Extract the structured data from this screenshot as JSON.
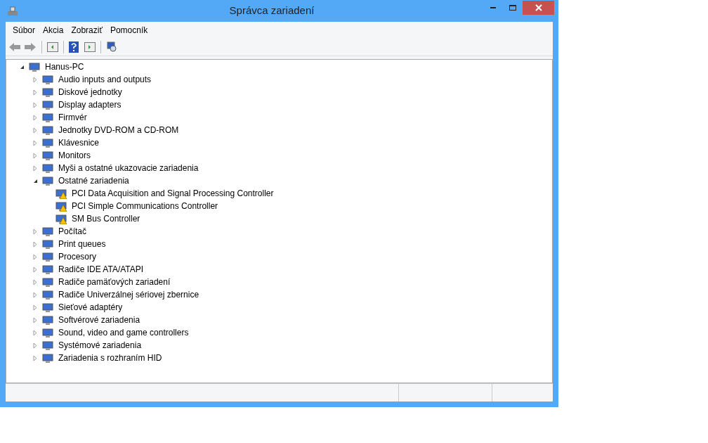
{
  "window": {
    "title": "Správca zariadení"
  },
  "menu": [
    "Súbor",
    "Akcia",
    "Zobraziť",
    "Pomocník"
  ],
  "tree": [
    {
      "label": "Hanus-PC",
      "expanded": true,
      "children": [
        {
          "label": "Audio inputs and outputs",
          "expanded": false
        },
        {
          "label": "Diskové jednotky",
          "expanded": false
        },
        {
          "label": "Display adapters",
          "expanded": false
        },
        {
          "label": "Firmvér",
          "expanded": false
        },
        {
          "label": "Jednotky DVD-ROM a CD-ROM",
          "expanded": false
        },
        {
          "label": "Klávesnice",
          "expanded": false
        },
        {
          "label": "Monitors",
          "expanded": false
        },
        {
          "label": "Myši a ostatné ukazovacie zariadenia",
          "expanded": false
        },
        {
          "label": "Ostatné zariadenia",
          "expanded": true,
          "children": [
            {
              "label": "PCI Data Acquisition and Signal Processing Controller",
              "warning": true
            },
            {
              "label": "PCI Simple Communications Controller",
              "warning": true
            },
            {
              "label": "SM Bus Controller",
              "warning": true
            }
          ]
        },
        {
          "label": "Počítač",
          "expanded": false
        },
        {
          "label": "Print queues",
          "expanded": false
        },
        {
          "label": "Procesory",
          "expanded": false
        },
        {
          "label": "Radiče IDE ATA/ATAPI",
          "expanded": false
        },
        {
          "label": "Radiče pamäťových zariadení",
          "expanded": false
        },
        {
          "label": "Radiče Univerzálnej sériovej zbernice",
          "expanded": false
        },
        {
          "label": "Sieťové adaptéry",
          "expanded": false
        },
        {
          "label": "Softvérové zariadenia",
          "expanded": false
        },
        {
          "label": "Sound, video and game controllers",
          "expanded": false
        },
        {
          "label": "Systémové zariadenia",
          "expanded": false
        },
        {
          "label": "Zariadenia s rozhraním HID",
          "expanded": false
        }
      ]
    }
  ]
}
